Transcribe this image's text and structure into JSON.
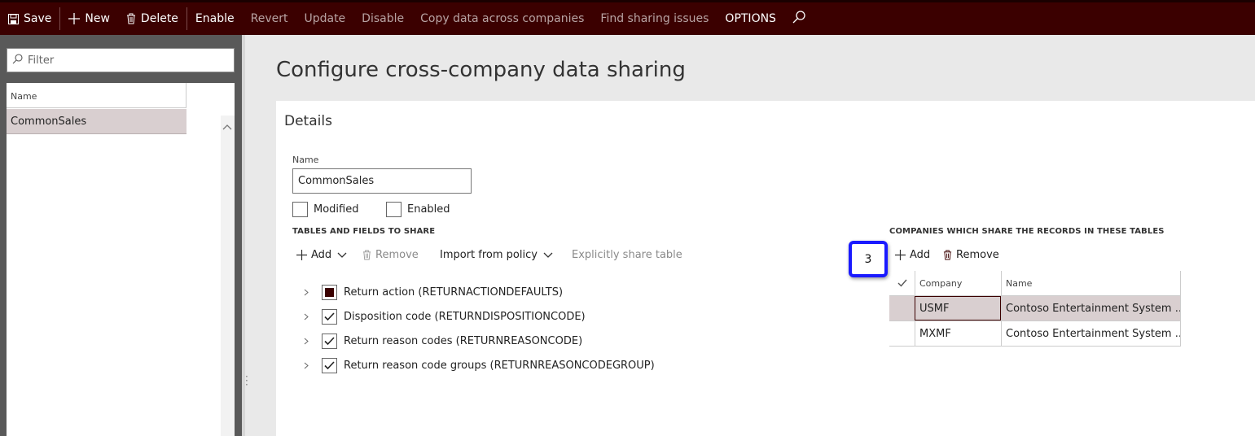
{
  "toolbar": {
    "save": "Save",
    "new": "New",
    "delete": "Delete",
    "enable": "Enable",
    "revert": "Revert",
    "update": "Update",
    "disable": "Disable",
    "copy_data": "Copy data across companies",
    "find_sharing": "Find sharing issues",
    "options": "OPTIONS"
  },
  "left": {
    "filter_placeholder": "Filter",
    "column_name": "Name",
    "items": [
      {
        "label": "CommonSales"
      }
    ]
  },
  "page": {
    "title": "Configure cross-company data sharing",
    "details_title": "Details",
    "name_label": "Name",
    "name_value": "CommonSales",
    "modified_label": "Modified",
    "modified_checked": false,
    "enabled_label": "Enabled",
    "enabled_checked": false
  },
  "tables": {
    "section_label": "TABLES AND FIELDS TO SHARE",
    "add_label": "Add",
    "remove_label": "Remove",
    "import_label": "Import from policy",
    "explicit_label": "Explicitly share table",
    "rows": [
      {
        "label": "Return action (RETURNACTIONDEFAULTS)",
        "state": "partial"
      },
      {
        "label": "Disposition code (RETURNDISPOSITIONCODE)",
        "state": "checked"
      },
      {
        "label": "Return reason codes (RETURNREASONCODE)",
        "state": "checked"
      },
      {
        "label": "Return reason code groups (RETURNREASONCODEGROUP)",
        "state": "checked"
      }
    ]
  },
  "companies": {
    "section_label": "COMPANIES WHICH SHARE THE RECORDS IN THESE TABLES",
    "add_label": "Add",
    "remove_label": "Remove",
    "col_company": "Company",
    "col_name": "Name",
    "rows": [
      {
        "company": "USMF",
        "name": "Contoso Entertainment System ..."
      },
      {
        "company": "MXMF",
        "name": "Contoso Entertainment System ..."
      }
    ]
  },
  "callout": {
    "step": "3"
  },
  "colors": {
    "brand": "#3b0000",
    "selection": "#d9cfd0",
    "callout_border": "#1a1aff"
  }
}
